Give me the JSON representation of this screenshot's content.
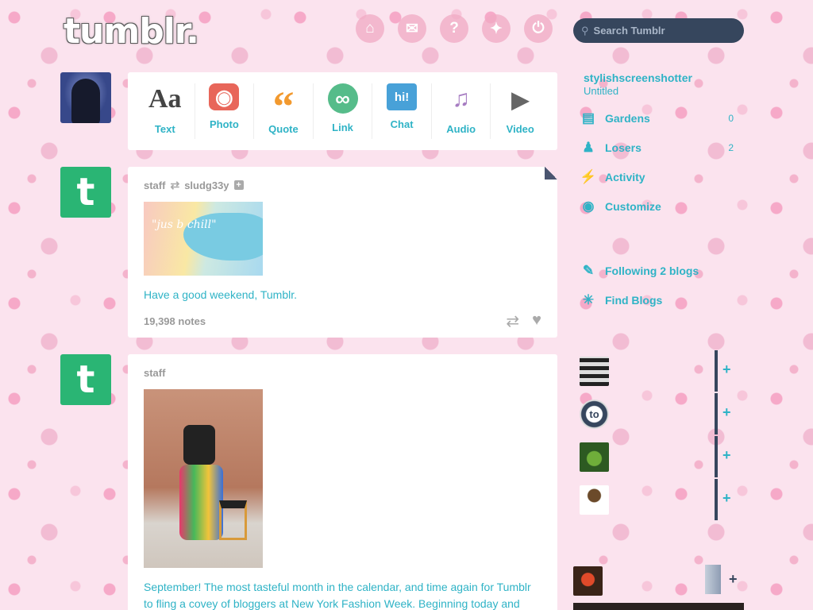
{
  "header": {
    "logo": "tumblr.",
    "nav_icons": [
      "home-icon",
      "mail-icon",
      "help-icon",
      "compass-icon",
      "power-icon"
    ],
    "search": {
      "placeholder": "Search Tumblr"
    }
  },
  "post_types": [
    {
      "label": "Text",
      "icon": "Aa"
    },
    {
      "label": "Photo",
      "icon": "camera"
    },
    {
      "label": "Quote",
      "icon": "quote"
    },
    {
      "label": "Link",
      "icon": "link"
    },
    {
      "label": "Chat",
      "icon": "hi!"
    },
    {
      "label": "Audio",
      "icon": "headphones"
    },
    {
      "label": "Video",
      "icon": "camcorder"
    }
  ],
  "posts": [
    {
      "author": "staff",
      "reblogged_from": "sludg33y",
      "image_text": "\"jus b chill\"",
      "caption": "Have a good weekend, Tumblr.",
      "notes": "19,398 notes"
    },
    {
      "author": "staff",
      "caption": "September! The most tasteful month in the calendar, and time again for Tumblr to fling a covey of bloggers at New York Fashion Week. Beginning today and"
    }
  ],
  "sidebar": {
    "blog_name": "stylishscreenshotter",
    "blog_subtitle": "Untitled",
    "items": [
      {
        "label": "Gardens",
        "count": "0"
      },
      {
        "label": "Losers",
        "count": "2"
      },
      {
        "label": "Activity",
        "count": ""
      },
      {
        "label": "Customize",
        "count": ""
      }
    ],
    "following": "Following 2 blogs",
    "find_blogs": "Find Blogs",
    "recommended_thumb_2": "to"
  },
  "colors": {
    "accent": "#2fb3c6",
    "navy": "#36465d",
    "tumblr_green": "#2ab574",
    "background": "#fbe3ee"
  }
}
